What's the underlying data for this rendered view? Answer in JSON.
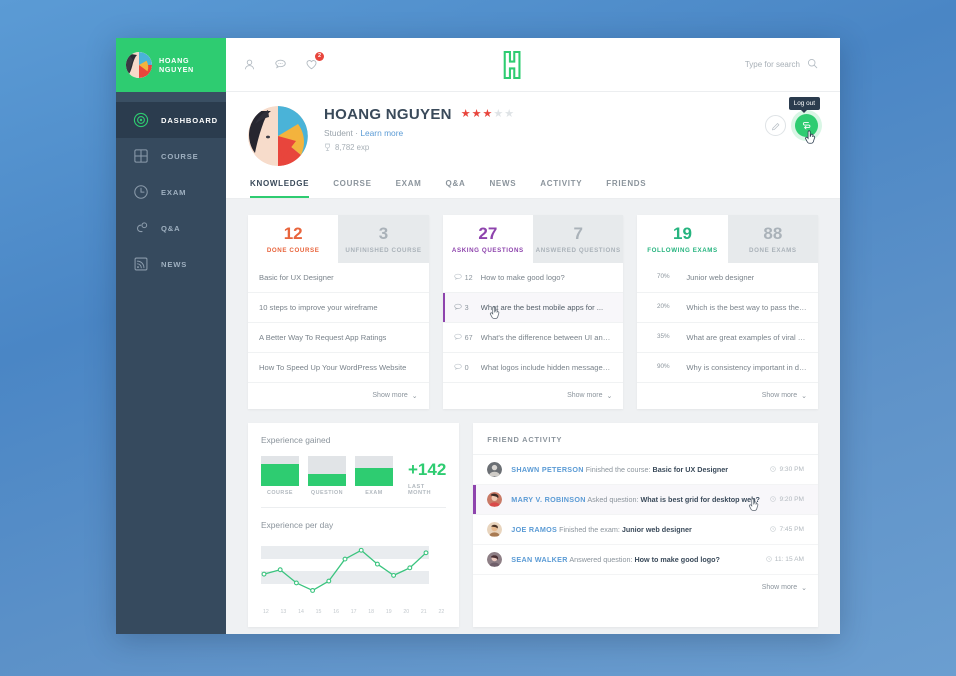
{
  "brand": {
    "name": "HOANG NGUYEN"
  },
  "sidebar": {
    "items": [
      {
        "label": "DASHBOARD",
        "icon": "target-icon",
        "active": true
      },
      {
        "label": "COURSE",
        "icon": "grid-icon",
        "active": false
      },
      {
        "label": "EXAM",
        "icon": "clock-icon",
        "active": false
      },
      {
        "label": "Q&A",
        "icon": "question-loop-icon",
        "active": false
      },
      {
        "label": "NEWS",
        "icon": "rss-icon",
        "active": false
      }
    ]
  },
  "topbar": {
    "icons": [
      {
        "name": "user-icon",
        "badge": ""
      },
      {
        "name": "chat-icon",
        "badge": ""
      },
      {
        "name": "heart-icon",
        "badge": "2"
      }
    ],
    "logo_letter": "H",
    "search": {
      "placeholder": "Type for search",
      "value": ""
    }
  },
  "profile": {
    "name": "HOANG NGUYEN",
    "rating": 3,
    "rating_max": 5,
    "role": "Student",
    "separator": "·",
    "learn_more": "Learn more",
    "exp": "8,782 exp",
    "edit_label": "Edit",
    "logout_tooltip": "Log out"
  },
  "tabs": [
    {
      "label": "KNOWLEDGE",
      "active": true
    },
    {
      "label": "COURSE",
      "active": false
    },
    {
      "label": "EXAM",
      "active": false
    },
    {
      "label": "Q&A",
      "active": false
    },
    {
      "label": "NEWS",
      "active": false
    },
    {
      "label": "ACTIVITY",
      "active": false
    },
    {
      "label": "FRIENDS",
      "active": false
    }
  ],
  "cards": [
    {
      "id": "course-card",
      "accent": "#e8643c",
      "heads": [
        {
          "num": "12",
          "label": "DONE COURSE",
          "active": true
        },
        {
          "num": "3",
          "label": "UNFINISHED COURSE",
          "active": false
        }
      ],
      "rows": [
        {
          "text": "Basic for UX Designer",
          "selected": false
        },
        {
          "text": "10 steps to improve your wireframe",
          "selected": false
        },
        {
          "text": "A Better Way To Request App Ratings",
          "selected": false
        },
        {
          "text": "How To Speed Up Your WordPress Website",
          "selected": false
        }
      ],
      "show_more": "Show more"
    },
    {
      "id": "questions-card",
      "accent": "#8e44ad",
      "heads": [
        {
          "num": "27",
          "label": "ASKING QUESTIONS",
          "active": true
        },
        {
          "num": "7",
          "label": "ANSWERED QUESTIONS",
          "active": false
        }
      ],
      "rows": [
        {
          "count": "12",
          "text": "How to make good logo?",
          "selected": false
        },
        {
          "count": "3",
          "text": "What are the best mobile apps for ...",
          "selected": true
        },
        {
          "count": "67",
          "text": "What's the difference between UI and ...",
          "selected": false
        },
        {
          "count": "0",
          "text": "What logos include hidden messages ...",
          "selected": false
        }
      ],
      "show_more": "Show more"
    },
    {
      "id": "exams-card",
      "accent": "#26b47f",
      "heads": [
        {
          "num": "19",
          "label": "FOLLOWING EXAMS",
          "active": true
        },
        {
          "num": "88",
          "label": "DONE EXAMS",
          "active": false
        }
      ],
      "rows": [
        {
          "pct": "70%",
          "pct_value": 70,
          "text": "Junior web designer",
          "selected": false
        },
        {
          "pct": "20%",
          "pct_value": 20,
          "text": "Which is the best way to pass the PMP ...",
          "selected": false
        },
        {
          "pct": "35%",
          "pct_value": 35,
          "text": "What are great examples of viral UX/UI ...",
          "selected": false
        },
        {
          "pct": "90%",
          "pct_value": 90,
          "text": "Why is consistency important in design?",
          "selected": false
        }
      ],
      "show_more": "Show more"
    }
  ],
  "experience": {
    "gained_title": "Experience gained",
    "per_day_title": "Experience per day",
    "total": "+142",
    "total_label": "LAST MONTH",
    "bars": [
      {
        "label": "COURSE",
        "fill": 72
      },
      {
        "label": "QUESTION",
        "fill": 40
      },
      {
        "label": "EXAM",
        "fill": 58
      }
    ]
  },
  "chart_data": {
    "type": "line",
    "title": "Experience per day",
    "xlabel": "",
    "ylabel": "",
    "x": [
      12,
      13,
      14,
      15,
      16,
      17,
      18,
      19,
      20,
      21,
      22
    ],
    "categories": [
      "12",
      "13",
      "14",
      "15",
      "16",
      "17",
      "18",
      "19",
      "20",
      "21",
      "22"
    ],
    "values": [
      38,
      45,
      24,
      12,
      27,
      62,
      76,
      54,
      36,
      48,
      72
    ],
    "ylim": [
      0,
      86
    ],
    "grid": true,
    "legend": "none",
    "series_color": "#3bc47f",
    "marker": "open-circle"
  },
  "friend_activity": {
    "title": "FRIEND ACTIVITY",
    "show_more": "Show more",
    "rows": [
      {
        "user": "SHAWN PETERSON",
        "action": "Finished the course:",
        "object": "Basic for UX Designer",
        "time": "9:30 PM",
        "selected": false
      },
      {
        "user": "MARY V. ROBINSON",
        "action": "Asked question:",
        "object": "What is best grid for desktop web?",
        "time": "9:20 PM",
        "selected": true
      },
      {
        "user": "JOE RAMOS",
        "action": "Finished the exam:",
        "object": "Junior web designer",
        "time": "7:45 PM",
        "selected": false
      },
      {
        "user": "SEAN WALKER",
        "action": "Answered question:",
        "object": "How to make good logo?",
        "time": "11: 15 AM",
        "selected": false
      }
    ]
  },
  "colors": {
    "brand_green": "#2ecc71",
    "sidebar": "#364a5e",
    "sidebar_active": "#2b3c4e",
    "orange": "#e8643c",
    "purple": "#8e44ad",
    "teal": "#26b47f",
    "blue_link": "#5b9bd5",
    "badge_red": "#e8453c"
  }
}
